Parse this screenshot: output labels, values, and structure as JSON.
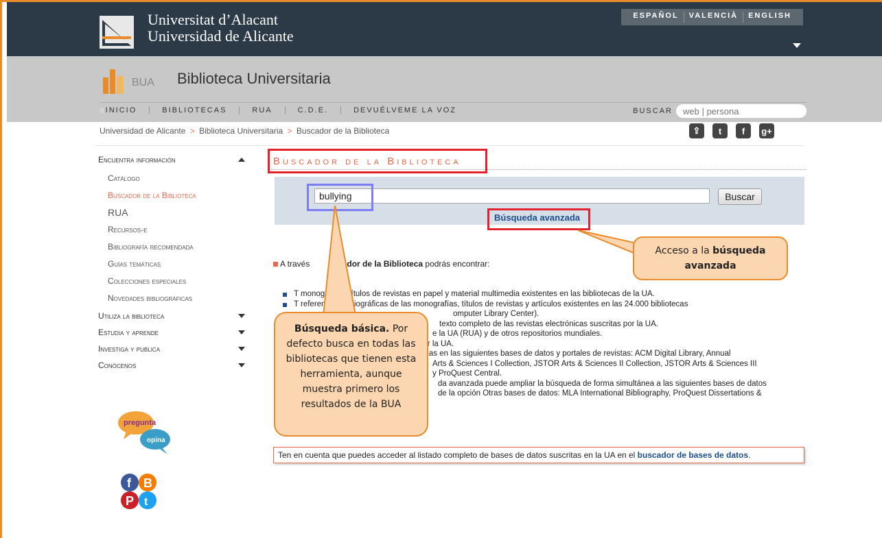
{
  "header": {
    "ua_name_line1": "Universitat d’Alacant",
    "ua_name_line2": "Universidad de Alicante",
    "languages": [
      "ESPAÑOL",
      "VALENCIÀ",
      "ENGLISH"
    ]
  },
  "library": {
    "logo_text": "BUA",
    "title": "Biblioteca Universitaria",
    "nav": [
      "INICIO",
      "BIBLIOTECAS",
      "RUA",
      "C.D.E.",
      "DEVUÉLVEME LA VOZ"
    ],
    "search_label": "BUSCAR",
    "search_placeholder": "web | persona"
  },
  "breadcrumb": [
    "Universidad de Alicante",
    "Biblioteca Universitaria",
    "Buscador de la Biblioteca"
  ],
  "breadcrumb_sep": ">",
  "social_top": [
    "share-icon",
    "twitter-icon",
    "facebook-icon",
    "google-plus-icon"
  ],
  "sidebar": {
    "sections": [
      {
        "label": "Encuentra información",
        "expanded": true
      },
      {
        "label": "Utiliza la biblioteca",
        "expanded": false
      },
      {
        "label": "Estudia y aprende",
        "expanded": false
      },
      {
        "label": "Investiga y publica",
        "expanded": false
      },
      {
        "label": "Conócenos",
        "expanded": false
      }
    ],
    "items": [
      "Catálogo",
      "Buscador de la Biblioteca",
      "RUA",
      "Recursos-e",
      "Bibliografía recomendada",
      "Guías temáticas",
      "Colecciones especiales",
      "Novedades bibliográficas"
    ],
    "pregunta_text": "pregunta",
    "opina_text": "opina"
  },
  "main": {
    "title": "Buscador de la Biblioteca",
    "query": "bullying",
    "search_button": "Buscar",
    "advanced_link": "Búsqueda avanzada",
    "intro_prefix": "A través",
    "intro_bold": "uscador de la Biblioteca",
    "intro_suffix": " podrás encontrar:",
    "bullets": [
      "T monografías, títulos de revistas en papel y material multimedia existentes en las bibliotecas de la UA.",
      "T referencias bibliográficas de las monografías, títulos de revistas y artículos existentes en las 24.000 bibliotecas",
      "omputer Library Center).",
      "texto completo de las revistas electrónicas suscritas por la UA.",
      "e la UA (RUA) y de otros repositorios mundiales.",
      "por la UA.",
      "tenidas en las siguientes bases de datos y portales de revistas: ACM Digital Library, Annual",
      "Arts & Sciences I Collection, JSTOR Arts & Sciences II Collection, JSTOR Arts & Sciences III",
      "y ProQuest Central.",
      "da avanzada puede ampliar la búsqueda de forma simultánea a las siguientes bases de datos",
      "de la opción Otras bases de datos: MLA International Bibliography, ProQuest Dissertations &"
    ],
    "notice_text": "Ten en cuenta que puedes acceder al listado completo de bases de datos suscritas en la UA en el ",
    "notice_link": "buscador de bases de datos",
    "notice_end": "."
  },
  "callouts": {
    "basic_bold": "Búsqueda básica.",
    "basic_text": " Por defecto busca en todas las bibliotecas que tienen esta herramienta, aunque muestra primero los resultados de la BUA",
    "advanced_prefix": "Acceso a la ",
    "advanced_bold": "búsqueda avanzada"
  },
  "colors": {
    "accent": "#e9674a",
    "topbar": "#2c3a47",
    "link_blue": "#1d4f8c",
    "callout_fill": "#fbd6b0",
    "callout_border": "#e98a2b",
    "highlight_red": "#e2222c",
    "highlight_blue": "#7a7ef0"
  }
}
